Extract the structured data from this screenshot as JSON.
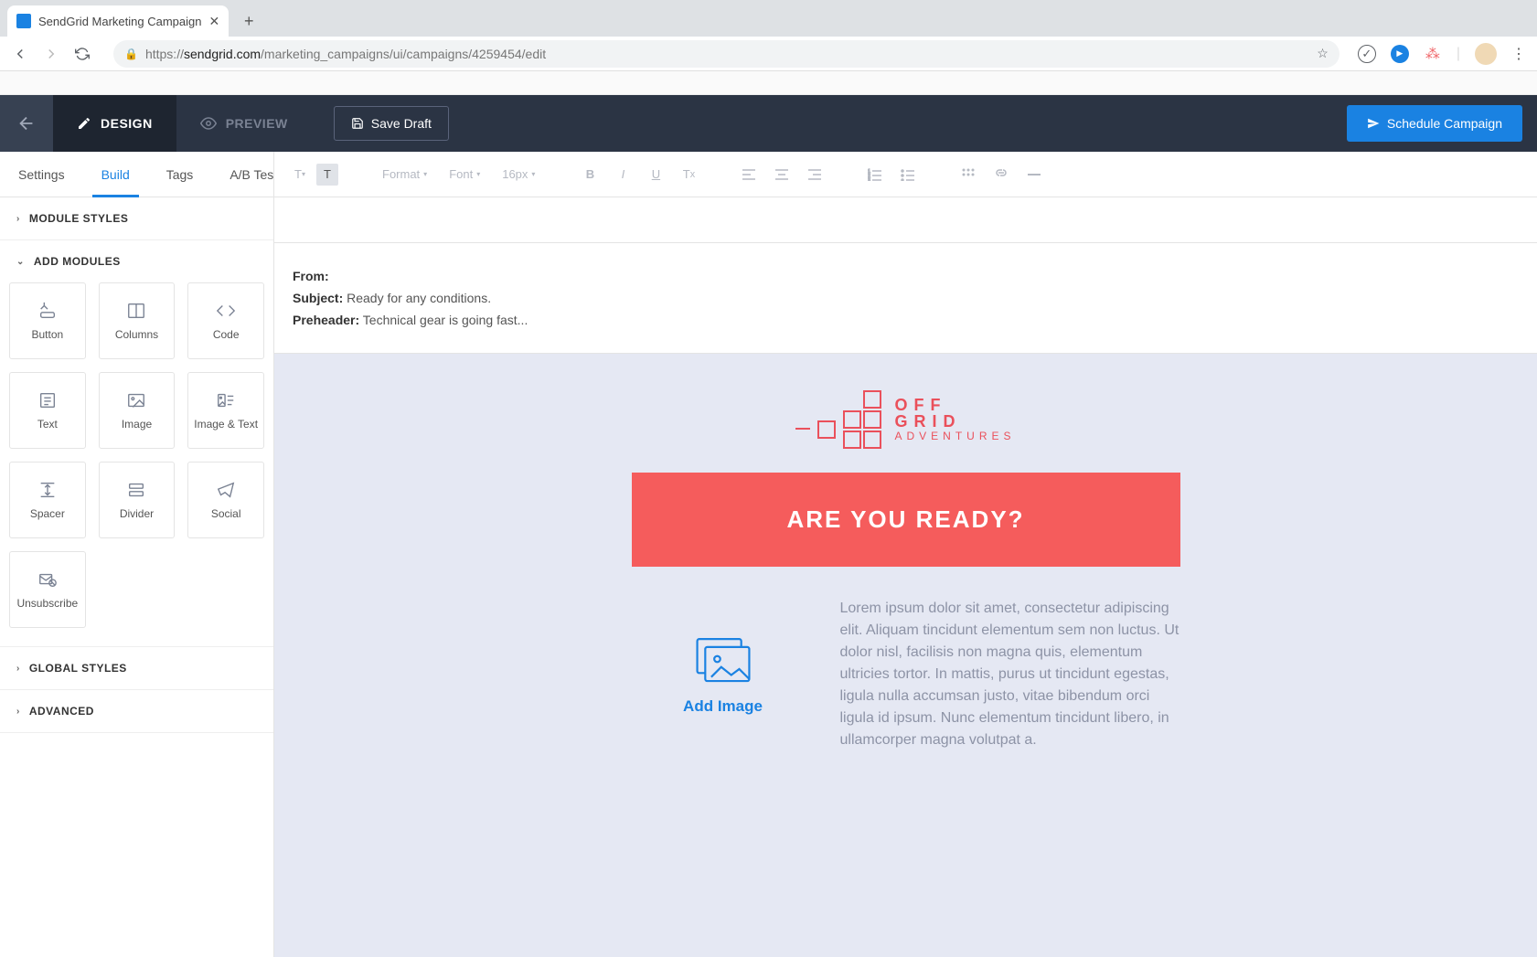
{
  "browser": {
    "tab_title": "SendGrid Marketing Campaign",
    "url_prefix": "https://",
    "url_host": "sendgrid.com",
    "url_path": "/marketing_campaigns/ui/campaigns/4259454/edit"
  },
  "header": {
    "design": "DESIGN",
    "preview": "PREVIEW",
    "save": "Save Draft",
    "schedule": "Schedule Campaign"
  },
  "side_tabs": {
    "settings": "Settings",
    "build": "Build",
    "tags": "Tags",
    "ab": "A/B Testing"
  },
  "accordion": {
    "module_styles": "MODULE STYLES",
    "add_modules": "ADD MODULES",
    "global_styles": "GLOBAL STYLES",
    "advanced": "ADVANCED"
  },
  "modules": {
    "button": "Button",
    "columns": "Columns",
    "code": "Code",
    "text": "Text",
    "image": "Image",
    "image_text": "Image & Text",
    "spacer": "Spacer",
    "divider": "Divider",
    "social": "Social",
    "unsubscribe": "Unsubscribe"
  },
  "toolbar": {
    "format": "Format",
    "font": "Font",
    "px": "16px"
  },
  "meta": {
    "from_label": "From:",
    "from_value": "",
    "subject_label": "Subject:",
    "subject_value": "Ready for any conditions.",
    "preheader_label": "Preheader:",
    "preheader_value": "Technical gear is going fast..."
  },
  "email": {
    "logo_line1": "OFF",
    "logo_line2": "GRID",
    "logo_line3": "ADVENTURES",
    "hero": "ARE YOU READY?",
    "add_image": "Add Image",
    "lorem": "Lorem ipsum dolor sit amet, consectetur adipiscing elit. Aliquam tincidunt elementum sem non luctus. Ut dolor nisl, facilisis non magna quis, elementum ultricies tortor. In mattis, purus ut tincidunt egestas, ligula nulla accumsan justo, vitae bibendum orci ligula id ipsum. Nunc elementum tincidunt libero, in ullamcorper magna volutpat a."
  }
}
